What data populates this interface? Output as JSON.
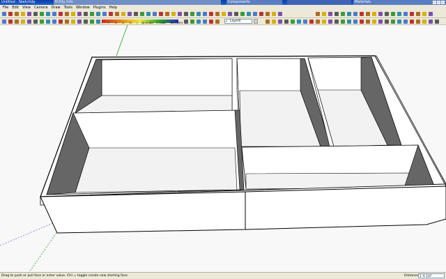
{
  "window": {
    "title": "Untitled - SketchUp",
    "entity_tab": "Entity Info",
    "components_tab": "Components",
    "materials_tab": "Materials"
  },
  "menu": [
    "File",
    "Edit",
    "View",
    "Camera",
    "Draw",
    "Tools",
    "Window",
    "Plugins",
    "Help"
  ],
  "toolbar": {
    "shadow_months": [
      "J",
      "F",
      "M",
      "A",
      "M",
      "J",
      "J",
      "A",
      "S",
      "O",
      "N",
      "D"
    ],
    "shadow_time_start": "06:43 AM",
    "shadow_noon": "Noon",
    "shadow_time_end": "04:46 PM",
    "layer": "Layer0"
  },
  "statusbar": {
    "hint": "Drag to push or pull face or enter value.  Ctrl = toggle create new starting face.",
    "vcb_label": "Distance",
    "vcb_value": "1' 6 1/4\""
  },
  "colors": {
    "viewport_bg": "#f7f8f7",
    "face_white": "#ffffff",
    "face_floor": "#f2f2f2",
    "face_shadow": "#666666",
    "edge": "#000000",
    "axis_green": "#4caf50"
  }
}
